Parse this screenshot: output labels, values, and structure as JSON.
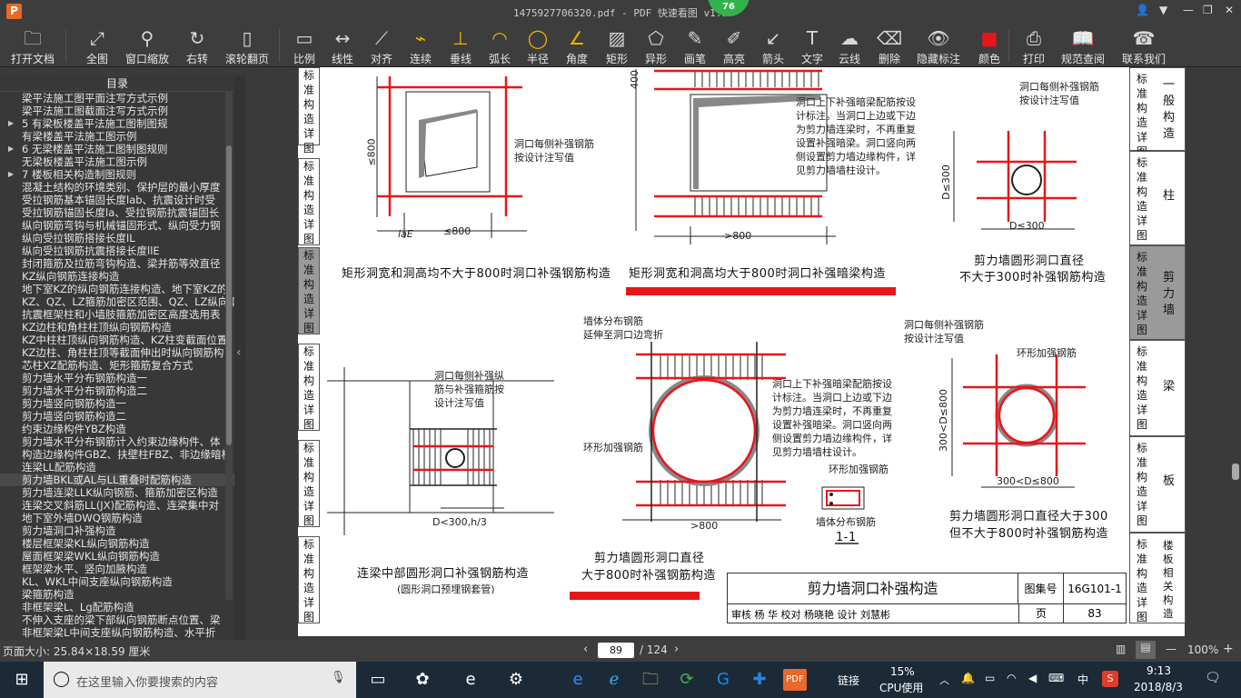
{
  "window": {
    "title": "1475927706320.pdf - PDF 快速看图 v1.9",
    "badge": "76",
    "logo_letter": "P"
  },
  "toolbar": [
    {
      "label": "打开文档",
      "icon": "folder-icon",
      "glyph": "🗀"
    },
    {
      "label": "全图",
      "icon": "fit-all-icon",
      "glyph": "⤢"
    },
    {
      "label": "窗口缩放",
      "icon": "zoom-window-icon",
      "glyph": "⚲"
    },
    {
      "label": "右转",
      "icon": "rotate-right-icon",
      "glyph": "↻"
    },
    {
      "label": "滚轮翻页",
      "icon": "mouse-scroll-icon",
      "glyph": "▯"
    },
    {
      "label": "比例",
      "icon": "scale-icon",
      "glyph": "▭"
    },
    {
      "label": "线性",
      "icon": "linear-measure-icon",
      "glyph": "↔"
    },
    {
      "label": "对齐",
      "icon": "align-measure-icon",
      "glyph": "⟋"
    },
    {
      "label": "连续",
      "icon": "continuous-measure-icon",
      "glyph": "⌁"
    },
    {
      "label": "垂线",
      "icon": "perpendicular-icon",
      "glyph": "⊥"
    },
    {
      "label": "弧长",
      "icon": "arc-length-icon",
      "glyph": "◠"
    },
    {
      "label": "半径",
      "icon": "radius-icon",
      "glyph": "◯"
    },
    {
      "label": "角度",
      "icon": "angle-icon",
      "glyph": "∠"
    },
    {
      "label": "矩形",
      "icon": "rectangle-area-icon",
      "glyph": "▨"
    },
    {
      "label": "异形",
      "icon": "polygon-area-icon",
      "glyph": "⬠"
    },
    {
      "label": "画笔",
      "icon": "pen-icon",
      "glyph": "✎"
    },
    {
      "label": "高亮",
      "icon": "highlighter-icon",
      "glyph": "✐"
    },
    {
      "label": "箭头",
      "icon": "arrow-icon",
      "glyph": "↙"
    },
    {
      "label": "文字",
      "icon": "text-icon",
      "glyph": "T"
    },
    {
      "label": "云线",
      "icon": "cloud-line-icon",
      "glyph": "☁"
    },
    {
      "label": "删除",
      "icon": "eraser-icon",
      "glyph": "⌫"
    },
    {
      "label": "隐藏标注",
      "icon": "hide-annotations-icon",
      "glyph": "👁"
    },
    {
      "label": "颜色",
      "icon": "color-icon",
      "glyph": "■"
    },
    {
      "label": "打印",
      "icon": "printer-icon",
      "glyph": "⎙"
    },
    {
      "label": "规范查阅",
      "icon": "book-icon",
      "glyph": "📖"
    },
    {
      "label": "联系我们",
      "icon": "support-icon",
      "glyph": "☎"
    }
  ],
  "sidebar": {
    "title": "目录",
    "items": [
      {
        "label": "梁平法施工图平面注写方式示例",
        "arrow": false
      },
      {
        "label": "梁平法施工图截面注写方式示例",
        "arrow": false
      },
      {
        "label": "5 有梁板楼盖平法施工图制图规",
        "arrow": true
      },
      {
        "label": "有梁楼盖平法施工图示例",
        "arrow": false
      },
      {
        "label": "6 无梁楼盖平法施工图制图规则",
        "arrow": true
      },
      {
        "label": "无梁板楼盖平法施工图示例",
        "arrow": false
      },
      {
        "label": "7 楼板相关构造制图规则",
        "arrow": true
      },
      {
        "label": "混凝土结构的环境类别、保护层的最小厚度",
        "arrow": false
      },
      {
        "label": "受拉钢筋基本锚固长度lab、抗震设计时受",
        "arrow": false
      },
      {
        "label": "受拉钢筋锚固长度la、受拉钢筋抗震锚固长",
        "arrow": false
      },
      {
        "label": "纵向钢筋弯钩与机械锚固形式、纵向受力钢",
        "arrow": false
      },
      {
        "label": "纵向受拉钢筋搭接长度lL",
        "arrow": false
      },
      {
        "label": "纵向受拉钢筋抗震搭接长度llE",
        "arrow": false
      },
      {
        "label": "封闭箍筋及拉筋弯钩构造、梁并筋等效直径",
        "arrow": false
      },
      {
        "label": "KZ纵向钢筋连接构造",
        "arrow": false
      },
      {
        "label": "地下室KZ的纵向钢筋连接构造、地下室KZ的",
        "arrow": false
      },
      {
        "label": "KZ、QZ、LZ箍筋加密区范围、QZ、LZ纵向钢",
        "arrow": false
      },
      {
        "label": "抗震框架柱和小墙肢箍筋加密区高度选用表",
        "arrow": false
      },
      {
        "label": "KZ边柱和角柱柱顶纵向钢筋构造",
        "arrow": false
      },
      {
        "label": "KZ中柱柱顶纵向钢筋构造、KZ柱变截面位置",
        "arrow": false
      },
      {
        "label": "KZ边柱、角柱柱顶等截面伸出时纵向钢筋构",
        "arrow": false
      },
      {
        "label": "芯柱XZ配筋构造、矩形箍筋复合方式",
        "arrow": false
      },
      {
        "label": "剪力墙水平分布钢筋构造一",
        "arrow": false
      },
      {
        "label": "剪力墙水平分布钢筋构造二",
        "arrow": false
      },
      {
        "label": "剪力墙竖向钢筋构造一",
        "arrow": false
      },
      {
        "label": "剪力墙竖向钢筋构造二",
        "arrow": false
      },
      {
        "label": "约束边缘构件YBZ构造",
        "arrow": false
      },
      {
        "label": "剪力墙水平分布钢筋计入约束边缘构件、体",
        "arrow": false
      },
      {
        "label": "构造边缘构件GBZ、扶壁柱FBZ、非边缘暗柱",
        "arrow": false
      },
      {
        "label": "连梁LL配筋构造",
        "arrow": false
      },
      {
        "label": "剪力墙BKL或AL与LL重叠时配筋构造",
        "arrow": false,
        "selected": true
      },
      {
        "label": "剪力墙连梁LLK纵向钢筋、箍筋加密区构造",
        "arrow": false
      },
      {
        "label": "连梁交叉斜筋LL(JX)配筋构造、连梁集中对",
        "arrow": false
      },
      {
        "label": "地下室外墙DWQ钢筋构造",
        "arrow": false
      },
      {
        "label": "剪力墙洞口补强构造",
        "arrow": false
      },
      {
        "label": "楼层框架梁KL纵向钢筋构造",
        "arrow": false
      },
      {
        "label": "屋面框架梁WKL纵向钢筋构造",
        "arrow": false
      },
      {
        "label": "框架梁水平、竖向加腋构造",
        "arrow": false
      },
      {
        "label": "KL、WKL中间支座纵向钢筋构造",
        "arrow": false
      },
      {
        "label": "梁箍筋构造",
        "arrow": false
      },
      {
        "label": "非框架梁L、Lg配筋构造",
        "arrow": false
      },
      {
        "label": "不伸入支座的梁下部纵向钢筋断点位置、梁",
        "arrow": false
      },
      {
        "label": "非框架梁L中间支座纵向钢筋构造、水平折",
        "arrow": false
      }
    ]
  },
  "drawing": {
    "left_tabs": [
      "标准构造详图",
      "标准构造详图",
      "标准构造详图",
      "标准构造详图",
      "标准构造详图",
      "标准构造详图"
    ],
    "right_tabs": [
      {
        "v1": "标准构造详图",
        "v2": "一般构造"
      },
      {
        "v1": "标准构造详图",
        "v2": "柱"
      },
      {
        "v1": "标准构造详图",
        "v2": "剪力墙",
        "active": true
      },
      {
        "v1": "标准构造详图",
        "v2": "梁"
      },
      {
        "v1": "标准构造详图",
        "v2": "板"
      },
      {
        "v1": "标准构造详图",
        "v2": "楼板相关构造"
      }
    ],
    "captions": {
      "rect_small": "矩形洞宽和洞高均不大于800时洞口补强钢筋构造",
      "rect_large": "矩形洞宽和洞高均大于800时洞口补强暗梁构造",
      "circ_300_l1": "剪力墙圆形洞口直径",
      "circ_300_l2": "不大于300时补强钢筋构造",
      "lintel_circle": "连梁中部圆形洞口补强钢筋构造",
      "lintel_circle_sub": "(圆形洞口预埋钢套管)",
      "circ_800_l1": "剪力墙圆形洞口直径",
      "circ_800_l2": "大于800时补强钢筋构造",
      "circ_mid_l1": "剪力墙圆形洞口直径大于300",
      "circ_mid_l2": "但不大于800时补强钢筋构造",
      "section": "1-1"
    },
    "notes": {
      "n1": "洞口每侧补强钢筋\n按设计注写值",
      "n2": "洞口上下补强暗梁配筋按设\n计标注。当洞口上边或下边\n为剪力墙连梁时，不再重复\n设置补强暗梁。洞口竖向两\n侧设置剪力墙边缘构件，详\n见剪力墙墙柱设计。",
      "n3": "洞口每侧补强钢筋\n按设计注写值",
      "n4": "墙体分布钢筋\n延伸至洞口边弯折",
      "n5": "洞口上下补强暗梁配筋按设\n计标注。当洞口上边或下边\n为剪力墙连梁时，不再重复\n设置补强暗梁。洞口竖向两\n侧设置剪力墙边缘构件，详\n见剪力墙墙柱设计。",
      "n6": "洞口每侧补强纵\n筋与补强箍筋按\n设计注写值",
      "n7": "洞口每侧补强钢筋\n按设计注写值",
      "n8": "环形加强钢筋",
      "n9": "环形加强钢筋",
      "n10": "环形加强钢筋",
      "n11": "墙体分布钢筋"
    },
    "dims": {
      "le800": "≤800",
      "le800b": "≤800",
      "gt800": ">800",
      "gt800b": ">800",
      "d300": "D≤300",
      "d300b": "D≤300",
      "d300_800": "300<D≤800",
      "d300_800v": "300<D≤800",
      "dh3": "D<300,h/3",
      "lae": "laE",
      "d400": "400"
    },
    "titleblock": {
      "title": "剪力墙洞口补强构造",
      "atlas_label": "图集号",
      "atlas_no": "16G101-1",
      "row2": "审核 杨 华   校对 杨晓艳   设计 刘慧彬",
      "page_label": "页",
      "page_no": "83"
    }
  },
  "statusbar": {
    "page_size": "页面大小: 25.84×18.59 厘米",
    "current_page": "89",
    "total_pages": "/ 124",
    "zoom": "100%"
  },
  "taskbar": {
    "search_placeholder": "在这里输入你要搜索的内容",
    "link_label": "链接",
    "cpu_percent": "15%",
    "cpu_label": "CPU使用",
    "ime": "中",
    "time": "9:13",
    "date": "2018/8/3"
  }
}
